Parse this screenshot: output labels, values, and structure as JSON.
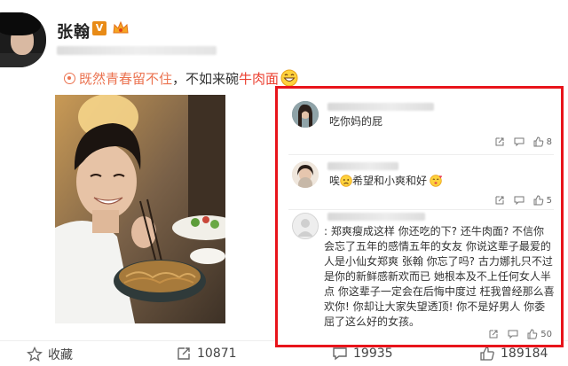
{
  "post": {
    "username": "张翰",
    "vip_badge": "V",
    "caption": {
      "topic": "既然青春留不住",
      "text_middle": "，不如来碗",
      "keyword": "牛肉面"
    },
    "actions": {
      "favorite_label": "收藏",
      "repost_count": "10871",
      "comment_count": "19935",
      "like_count": "189184"
    }
  },
  "comments": [
    {
      "text": "吃你妈的屁",
      "like_count": "8"
    },
    {
      "text_before": "唉",
      "text_after": "希望和小爽和好",
      "like_count": "5"
    },
    {
      "lines": [
        ": 郑爽瘦成这样 你还吃的下? 还牛肉面? 不信你",
        "会忘了五年的感情五年的女友 你说这辈子最爱的",
        "人是小仙女郑爽 张翰 你忘了吗? 古力娜扎只不过",
        "是你的新鲜感新欢而已 她根本及不上任何女人半",
        "点 你这辈子一定会在后悔中度过 枉我曾经那么喜",
        "欢你! 你却让大家失望透顶! 你不是好男人 你委",
        "屈了这么好的女孩。"
      ],
      "like_count": "50"
    }
  ],
  "colors": {
    "accent": "#eb7350",
    "highlight_border": "#e8141b"
  }
}
